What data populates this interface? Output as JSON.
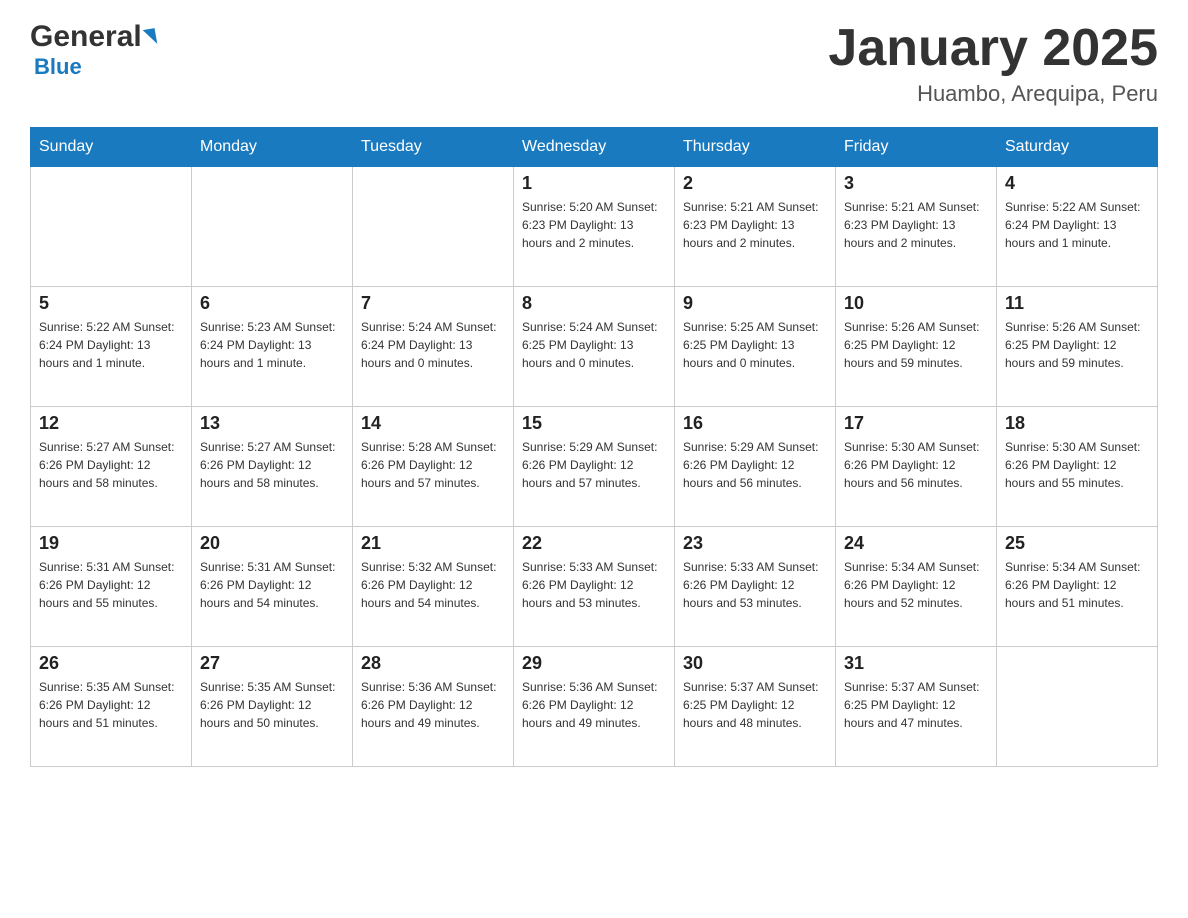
{
  "header": {
    "logo_general": "General",
    "logo_blue": "Blue",
    "month_title": "January 2025",
    "location": "Huambo, Arequipa, Peru"
  },
  "days_of_week": [
    "Sunday",
    "Monday",
    "Tuesday",
    "Wednesday",
    "Thursday",
    "Friday",
    "Saturday"
  ],
  "weeks": [
    [
      {
        "day": "",
        "info": ""
      },
      {
        "day": "",
        "info": ""
      },
      {
        "day": "",
        "info": ""
      },
      {
        "day": "1",
        "info": "Sunrise: 5:20 AM\nSunset: 6:23 PM\nDaylight: 13 hours and 2 minutes."
      },
      {
        "day": "2",
        "info": "Sunrise: 5:21 AM\nSunset: 6:23 PM\nDaylight: 13 hours and 2 minutes."
      },
      {
        "day": "3",
        "info": "Sunrise: 5:21 AM\nSunset: 6:23 PM\nDaylight: 13 hours and 2 minutes."
      },
      {
        "day": "4",
        "info": "Sunrise: 5:22 AM\nSunset: 6:24 PM\nDaylight: 13 hours and 1 minute."
      }
    ],
    [
      {
        "day": "5",
        "info": "Sunrise: 5:22 AM\nSunset: 6:24 PM\nDaylight: 13 hours and 1 minute."
      },
      {
        "day": "6",
        "info": "Sunrise: 5:23 AM\nSunset: 6:24 PM\nDaylight: 13 hours and 1 minute."
      },
      {
        "day": "7",
        "info": "Sunrise: 5:24 AM\nSunset: 6:24 PM\nDaylight: 13 hours and 0 minutes."
      },
      {
        "day": "8",
        "info": "Sunrise: 5:24 AM\nSunset: 6:25 PM\nDaylight: 13 hours and 0 minutes."
      },
      {
        "day": "9",
        "info": "Sunrise: 5:25 AM\nSunset: 6:25 PM\nDaylight: 13 hours and 0 minutes."
      },
      {
        "day": "10",
        "info": "Sunrise: 5:26 AM\nSunset: 6:25 PM\nDaylight: 12 hours and 59 minutes."
      },
      {
        "day": "11",
        "info": "Sunrise: 5:26 AM\nSunset: 6:25 PM\nDaylight: 12 hours and 59 minutes."
      }
    ],
    [
      {
        "day": "12",
        "info": "Sunrise: 5:27 AM\nSunset: 6:26 PM\nDaylight: 12 hours and 58 minutes."
      },
      {
        "day": "13",
        "info": "Sunrise: 5:27 AM\nSunset: 6:26 PM\nDaylight: 12 hours and 58 minutes."
      },
      {
        "day": "14",
        "info": "Sunrise: 5:28 AM\nSunset: 6:26 PM\nDaylight: 12 hours and 57 minutes."
      },
      {
        "day": "15",
        "info": "Sunrise: 5:29 AM\nSunset: 6:26 PM\nDaylight: 12 hours and 57 minutes."
      },
      {
        "day": "16",
        "info": "Sunrise: 5:29 AM\nSunset: 6:26 PM\nDaylight: 12 hours and 56 minutes."
      },
      {
        "day": "17",
        "info": "Sunrise: 5:30 AM\nSunset: 6:26 PM\nDaylight: 12 hours and 56 minutes."
      },
      {
        "day": "18",
        "info": "Sunrise: 5:30 AM\nSunset: 6:26 PM\nDaylight: 12 hours and 55 minutes."
      }
    ],
    [
      {
        "day": "19",
        "info": "Sunrise: 5:31 AM\nSunset: 6:26 PM\nDaylight: 12 hours and 55 minutes."
      },
      {
        "day": "20",
        "info": "Sunrise: 5:31 AM\nSunset: 6:26 PM\nDaylight: 12 hours and 54 minutes."
      },
      {
        "day": "21",
        "info": "Sunrise: 5:32 AM\nSunset: 6:26 PM\nDaylight: 12 hours and 54 minutes."
      },
      {
        "day": "22",
        "info": "Sunrise: 5:33 AM\nSunset: 6:26 PM\nDaylight: 12 hours and 53 minutes."
      },
      {
        "day": "23",
        "info": "Sunrise: 5:33 AM\nSunset: 6:26 PM\nDaylight: 12 hours and 53 minutes."
      },
      {
        "day": "24",
        "info": "Sunrise: 5:34 AM\nSunset: 6:26 PM\nDaylight: 12 hours and 52 minutes."
      },
      {
        "day": "25",
        "info": "Sunrise: 5:34 AM\nSunset: 6:26 PM\nDaylight: 12 hours and 51 minutes."
      }
    ],
    [
      {
        "day": "26",
        "info": "Sunrise: 5:35 AM\nSunset: 6:26 PM\nDaylight: 12 hours and 51 minutes."
      },
      {
        "day": "27",
        "info": "Sunrise: 5:35 AM\nSunset: 6:26 PM\nDaylight: 12 hours and 50 minutes."
      },
      {
        "day": "28",
        "info": "Sunrise: 5:36 AM\nSunset: 6:26 PM\nDaylight: 12 hours and 49 minutes."
      },
      {
        "day": "29",
        "info": "Sunrise: 5:36 AM\nSunset: 6:26 PM\nDaylight: 12 hours and 49 minutes."
      },
      {
        "day": "30",
        "info": "Sunrise: 5:37 AM\nSunset: 6:25 PM\nDaylight: 12 hours and 48 minutes."
      },
      {
        "day": "31",
        "info": "Sunrise: 5:37 AM\nSunset: 6:25 PM\nDaylight: 12 hours and 47 minutes."
      },
      {
        "day": "",
        "info": ""
      }
    ]
  ]
}
